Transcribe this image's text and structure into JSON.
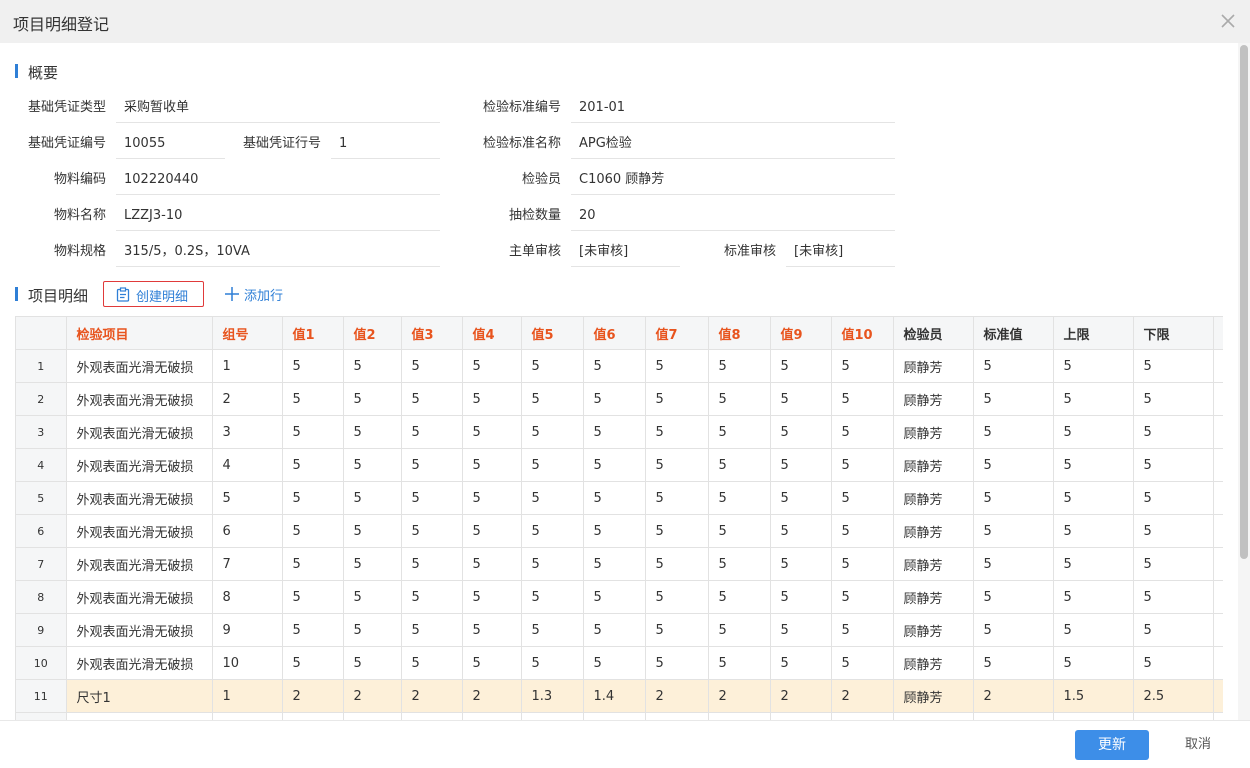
{
  "dialog": {
    "title": "项目明细登记"
  },
  "summary": {
    "heading": "概要",
    "fields": {
      "base_voucher_type": {
        "label": "基础凭证类型",
        "value": "采购暂收单"
      },
      "base_voucher_no": {
        "label": "基础凭证编号",
        "value": "10055"
      },
      "base_voucher_line": {
        "label": "基础凭证行号",
        "value": "1"
      },
      "material_code": {
        "label": "物料编码",
        "value": "102220440"
      },
      "material_name": {
        "label": "物料名称",
        "value": "LZZJ3-10"
      },
      "material_spec": {
        "label": "物料规格",
        "value": "315/5，0.2S，10VA"
      },
      "standard_no": {
        "label": "检验标准编号",
        "value": "201-01"
      },
      "standard_name": {
        "label": "检验标准名称",
        "value": "APG检验"
      },
      "inspector": {
        "label": "检验员",
        "value": "C1060 顾静芳"
      },
      "sample_qty": {
        "label": "抽检数量",
        "value": "20"
      },
      "main_review": {
        "label": "主单审核",
        "value": "[未审核]"
      },
      "standard_review": {
        "label": "标准审核",
        "value": "[未审核]"
      }
    }
  },
  "detail": {
    "heading": "项目明细",
    "create_label": "创建明细",
    "add_label": "添加行",
    "columns": [
      "检验项目",
      "组号",
      "值1",
      "值2",
      "值3",
      "值4",
      "值5",
      "值6",
      "值7",
      "值8",
      "值9",
      "值10",
      "检验员",
      "标准值",
      "上限",
      "下限"
    ],
    "rows": [
      [
        "1",
        "外观表面光滑无破损",
        "1",
        "5",
        "5",
        "5",
        "5",
        "5",
        "5",
        "5",
        "5",
        "5",
        "5",
        "顾静芳",
        "5",
        "5",
        "5"
      ],
      [
        "2",
        "外观表面光滑无破损",
        "2",
        "5",
        "5",
        "5",
        "5",
        "5",
        "5",
        "5",
        "5",
        "5",
        "5",
        "顾静芳",
        "5",
        "5",
        "5"
      ],
      [
        "3",
        "外观表面光滑无破损",
        "3",
        "5",
        "5",
        "5",
        "5",
        "5",
        "5",
        "5",
        "5",
        "5",
        "5",
        "顾静芳",
        "5",
        "5",
        "5"
      ],
      [
        "4",
        "外观表面光滑无破损",
        "4",
        "5",
        "5",
        "5",
        "5",
        "5",
        "5",
        "5",
        "5",
        "5",
        "5",
        "顾静芳",
        "5",
        "5",
        "5"
      ],
      [
        "5",
        "外观表面光滑无破损",
        "5",
        "5",
        "5",
        "5",
        "5",
        "5",
        "5",
        "5",
        "5",
        "5",
        "5",
        "顾静芳",
        "5",
        "5",
        "5"
      ],
      [
        "6",
        "外观表面光滑无破损",
        "6",
        "5",
        "5",
        "5",
        "5",
        "5",
        "5",
        "5",
        "5",
        "5",
        "5",
        "顾静芳",
        "5",
        "5",
        "5"
      ],
      [
        "7",
        "外观表面光滑无破损",
        "7",
        "5",
        "5",
        "5",
        "5",
        "5",
        "5",
        "5",
        "5",
        "5",
        "5",
        "顾静芳",
        "5",
        "5",
        "5"
      ],
      [
        "8",
        "外观表面光滑无破损",
        "8",
        "5",
        "5",
        "5",
        "5",
        "5",
        "5",
        "5",
        "5",
        "5",
        "5",
        "顾静芳",
        "5",
        "5",
        "5"
      ],
      [
        "9",
        "外观表面光滑无破损",
        "9",
        "5",
        "5",
        "5",
        "5",
        "5",
        "5",
        "5",
        "5",
        "5",
        "5",
        "顾静芳",
        "5",
        "5",
        "5"
      ],
      [
        "10",
        "外观表面光滑无破损",
        "10",
        "5",
        "5",
        "5",
        "5",
        "5",
        "5",
        "5",
        "5",
        "5",
        "5",
        "顾静芳",
        "5",
        "5",
        "5"
      ],
      [
        "11",
        "尺寸1",
        "1",
        "2",
        "2",
        "2",
        "2",
        "1.3",
        "1.4",
        "2",
        "2",
        "2",
        "2",
        "顾静芳",
        "2",
        "1.5",
        "2.5"
      ]
    ],
    "highlighted_row": "11"
  },
  "footer": {
    "update_label": "更新",
    "cancel_label": "取消"
  },
  "colors": {
    "accent": "#2f7fd6",
    "required_header": "#e8541e",
    "primary_button": "#3d8ee8",
    "highlight_row": "#fdf0d9"
  },
  "icons": {
    "close": "close-icon",
    "create": "clipboard-icon",
    "add": "plus-icon"
  }
}
